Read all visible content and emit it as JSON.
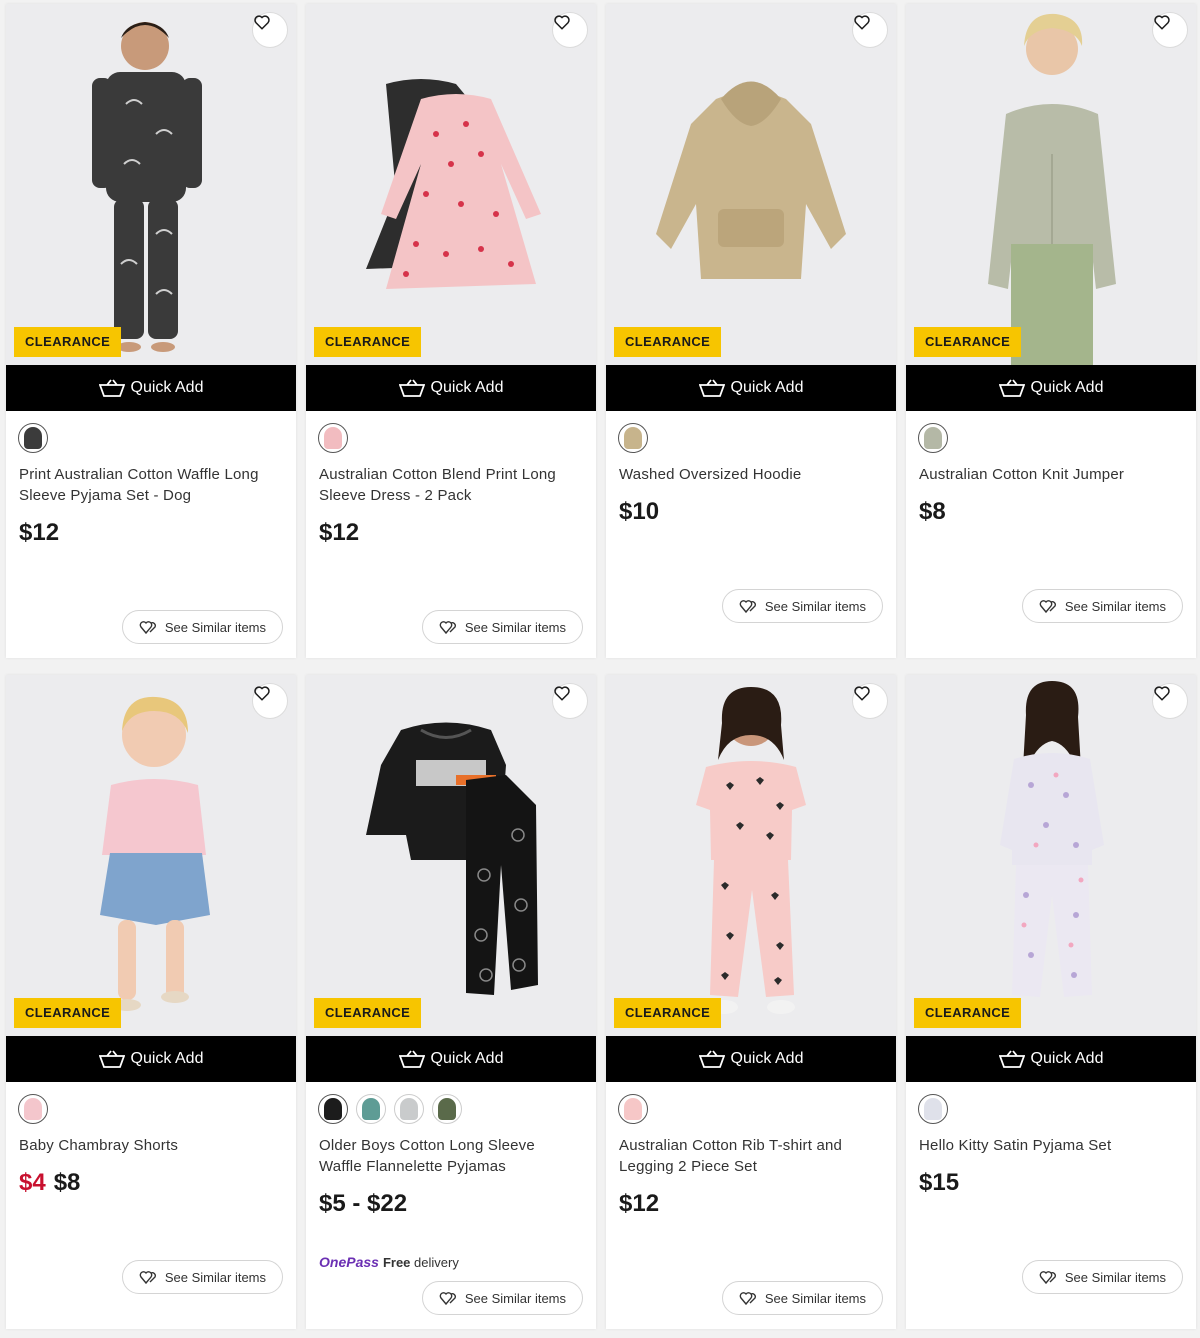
{
  "common": {
    "badge": "CLEARANCE",
    "quick_add": "Quick Add",
    "see_similar": "See Similar items"
  },
  "products": [
    {
      "title": "Print Australian Cotton Waffle Long Sleeve Pyjama Set - Dog",
      "price": "$12",
      "swatches": [
        "#3b3b3b"
      ]
    },
    {
      "title": "Australian Cotton Blend Print Long Sleeve Dress - 2 Pack",
      "price": "$12",
      "swatches": [
        "#f2bcc0"
      ]
    },
    {
      "title": "Washed Oversized Hoodie",
      "price": "$10",
      "swatches": [
        "#c7b48c"
      ]
    },
    {
      "title": "Australian Cotton Knit Jumper",
      "price": "$8",
      "swatches": [
        "#b4b8a6"
      ]
    },
    {
      "title": "Baby Chambray Shorts",
      "price_sale": "$4",
      "price_was": "$8",
      "swatches": [
        "#f4c6cc"
      ]
    },
    {
      "title": "Older Boys Cotton Long Sleeve Waffle Flannelette Pyjamas",
      "price": "$5 - $22",
      "swatches": [
        "#1c1c1c",
        "#5e9c95",
        "#c9cbcc",
        "#5a6a4a"
      ],
      "onepass": {
        "brand": "OnePass",
        "free": "Free",
        "delivery": "delivery"
      }
    },
    {
      "title": "Australian Cotton Rib T-shirt and Legging 2 Piece Set",
      "price": "$12",
      "swatches": [
        "#f6c7c7"
      ]
    },
    {
      "title": "Hello Kitty Satin Pyjama Set",
      "price": "$15",
      "swatches": [
        "#dfe1ea"
      ]
    }
  ],
  "colors": {
    "badge_bg": "#f7c500",
    "quick_add_bg": "#000000",
    "sale_price": "#c8102e",
    "onepass_brand": "#6b2fb3"
  }
}
